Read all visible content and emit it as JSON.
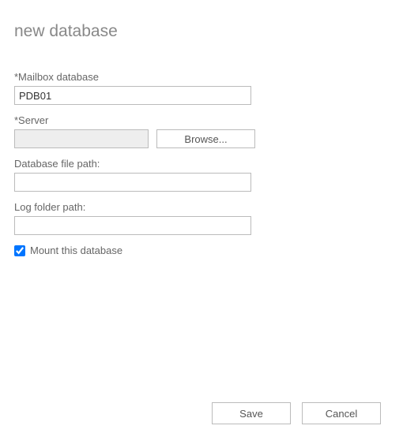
{
  "header": {
    "title": "new database"
  },
  "form": {
    "mailbox_db_label": "*Mailbox database",
    "mailbox_db_value": "PDB01",
    "server_label": "*Server",
    "server_value": "",
    "browse_label": "Browse...",
    "db_file_path_label": "Database file path:",
    "db_file_path_value": "",
    "log_folder_path_label": "Log folder path:",
    "log_folder_path_value": "",
    "mount_checkbox_label": "Mount this database",
    "mount_checkbox_checked": true
  },
  "footer": {
    "save_label": "Save",
    "cancel_label": "Cancel"
  }
}
